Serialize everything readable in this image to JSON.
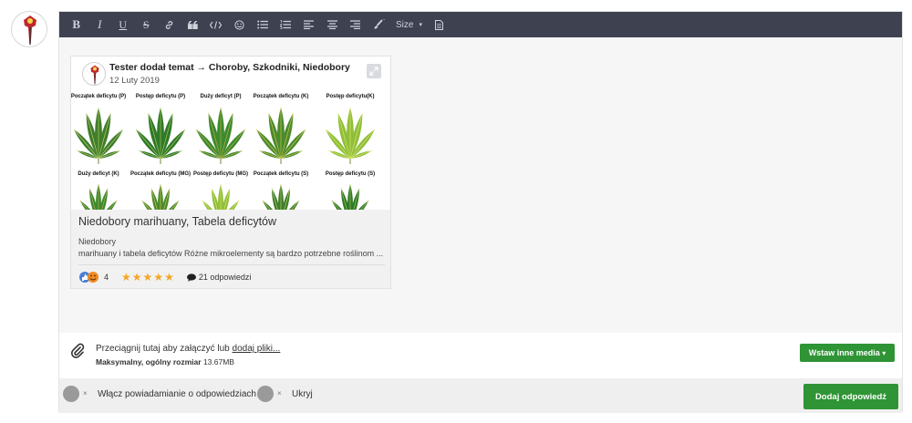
{
  "toolbar": {
    "buttons": [
      "bold",
      "italic",
      "underline",
      "strikethrough",
      "link",
      "quote",
      "code",
      "emoji",
      "bullet-list",
      "numbered-list",
      "align-left",
      "align-center",
      "align-right",
      "color"
    ],
    "bold": "B",
    "italic": "I",
    "underline": "U",
    "strike": "S",
    "size_label": "Size",
    "size_caret": "▾"
  },
  "card": {
    "author_line": "Tester dodał temat → Choroby, Szkodniki, Niedobory",
    "date": "12 Luty 2019",
    "image_labels_row1": [
      "Początek deficytu (P)",
      "Postęp deficytu (P)",
      "Duży deficyt (P)",
      "Początek deficytu (K)",
      "Postęp deficytu(K)"
    ],
    "image_labels_row2": [
      "Duży deficyt (K)",
      "Początek deficytu (MG)",
      "Postęp deficytu (MG)",
      "Początek deficytu (S)",
      "Postęp deficytu (S)"
    ],
    "title": "Niedobory marihuany, Tabela deficytów",
    "subtitle": "Niedobory",
    "excerpt": "marihuany i tabela deficytów  Różne mikroelementy są bardzo potrzebne roślinom ...",
    "reaction_count": "4",
    "rating": 5,
    "replies": "21 odpowiedzi"
  },
  "attach": {
    "drag_text": "Przeciągnij tutaj aby załączyć lub",
    "link_text": "dodaj pliki...",
    "max_label": "Maksymalny, ogólny rozmiar",
    "max_value": "13.67MB",
    "media_button": "Wstaw inne media",
    "media_caret": "▾"
  },
  "footer": {
    "notify_label": "Włącz powiadamianie o odpowiedziach",
    "hide_label": "Ukryj",
    "toggle_x": "×",
    "submit": "Dodaj odpowiedź"
  },
  "colors": {
    "toolbar_bg": "#3d4150",
    "green": "#2e9435",
    "star": "#f5a623"
  }
}
